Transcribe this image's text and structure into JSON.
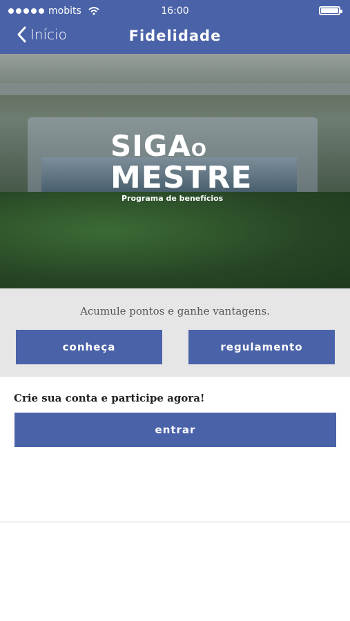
{
  "status_bar": {
    "carrier": "mobits",
    "time": "16:00"
  },
  "nav": {
    "back_label": "Início",
    "title": "Fidelidade"
  },
  "hero": {
    "logo_line1": "SIGA",
    "logo_o": "O",
    "logo_line2": "MESTRE",
    "logo_tagline": "Programa de benefícios"
  },
  "promo": {
    "text": "Acumule pontos e ganhe vantagens.",
    "button_conheca": "conheça",
    "button_regulamento": "regulamento"
  },
  "signup": {
    "text": "Crie sua conta e participe agora!",
    "button_entrar": "entrar"
  },
  "colors": {
    "brand": "#4a62a8",
    "promo_bg": "#e6e6e6"
  }
}
